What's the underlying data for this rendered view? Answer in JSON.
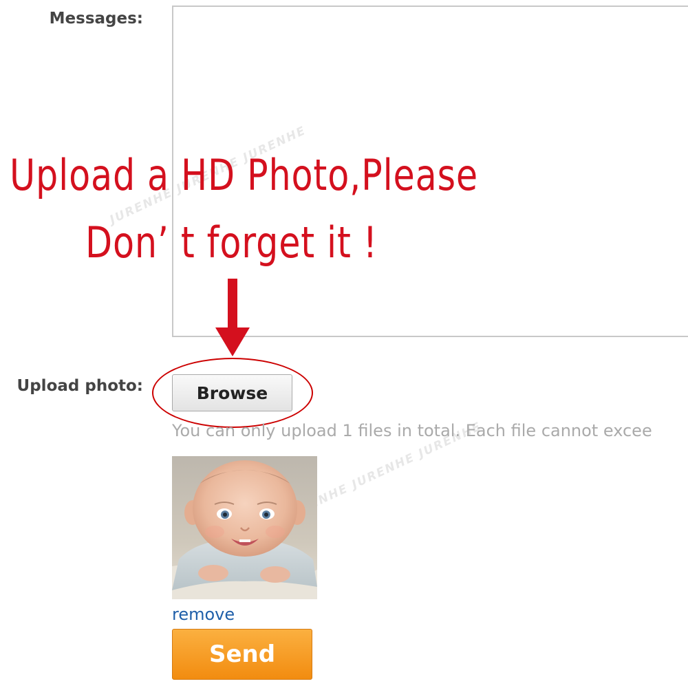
{
  "form": {
    "messages_label": "Messages:",
    "messages_value": "",
    "upload_label": "Upload photo:",
    "browse_label": "Browse",
    "upload_hint": "You can only upload 1 files in total. Each file cannot excee",
    "remove_label": "remove",
    "send_label": "Send"
  },
  "annotation": {
    "line1": "Upload a HD Photo,Please",
    "line2": "Don’ t forget it !"
  },
  "watermark": {
    "text": "JURENHE JURENHE JURENHE"
  },
  "colors": {
    "annotation_red": "#d4101e",
    "send_orange": "#f7a021",
    "link_blue": "#1f5fa9",
    "label_gray": "#444444",
    "hint_gray": "#aaaaaa"
  },
  "icons": {
    "arrow": "arrow-down-icon",
    "highlight": "ellipse-highlight"
  }
}
